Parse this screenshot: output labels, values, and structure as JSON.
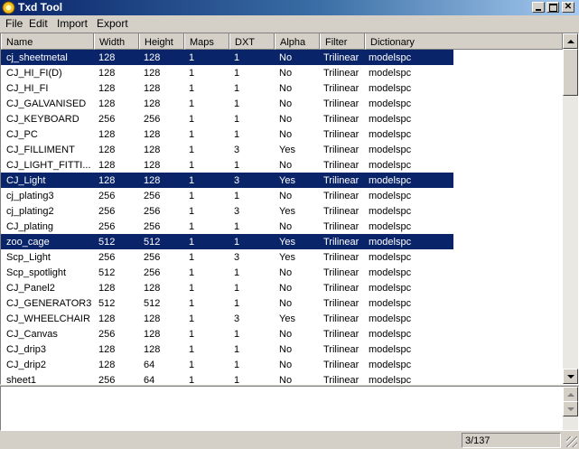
{
  "window": {
    "title": "Txd Tool"
  },
  "menu": [
    "File",
    "Edit",
    "Import",
    "Export"
  ],
  "columns": [
    "Name",
    "Width",
    "Height",
    "Maps",
    "DXT",
    "Alpha",
    "Filter",
    "Dictionary"
  ],
  "rows": [
    {
      "name": "cj_sheetmetal",
      "width": "128",
      "height": "128",
      "maps": "1",
      "dxt": "1",
      "alpha": "No",
      "filter": "Trilinear",
      "dict": "modelspc",
      "selected": true
    },
    {
      "name": "CJ_HI_FI(D)",
      "width": "128",
      "height": "128",
      "maps": "1",
      "dxt": "1",
      "alpha": "No",
      "filter": "Trilinear",
      "dict": "modelspc",
      "selected": false
    },
    {
      "name": "CJ_HI_FI",
      "width": "128",
      "height": "128",
      "maps": "1",
      "dxt": "1",
      "alpha": "No",
      "filter": "Trilinear",
      "dict": "modelspc",
      "selected": false
    },
    {
      "name": "CJ_GALVANISED",
      "width": "128",
      "height": "128",
      "maps": "1",
      "dxt": "1",
      "alpha": "No",
      "filter": "Trilinear",
      "dict": "modelspc",
      "selected": false
    },
    {
      "name": "CJ_KEYBOARD",
      "width": "256",
      "height": "256",
      "maps": "1",
      "dxt": "1",
      "alpha": "No",
      "filter": "Trilinear",
      "dict": "modelspc",
      "selected": false
    },
    {
      "name": "CJ_PC",
      "width": "128",
      "height": "128",
      "maps": "1",
      "dxt": "1",
      "alpha": "No",
      "filter": "Trilinear",
      "dict": "modelspc",
      "selected": false
    },
    {
      "name": "CJ_FILLIMENT",
      "width": "128",
      "height": "128",
      "maps": "1",
      "dxt": "3",
      "alpha": "Yes",
      "filter": "Trilinear",
      "dict": "modelspc",
      "selected": false
    },
    {
      "name": "CJ_LIGHT_FITTI...",
      "width": "128",
      "height": "128",
      "maps": "1",
      "dxt": "1",
      "alpha": "No",
      "filter": "Trilinear",
      "dict": "modelspc",
      "selected": false
    },
    {
      "name": "CJ_Light",
      "width": "128",
      "height": "128",
      "maps": "1",
      "dxt": "3",
      "alpha": "Yes",
      "filter": "Trilinear",
      "dict": "modelspc",
      "selected": true
    },
    {
      "name": "cj_plating3",
      "width": "256",
      "height": "256",
      "maps": "1",
      "dxt": "1",
      "alpha": "No",
      "filter": "Trilinear",
      "dict": "modelspc",
      "selected": false
    },
    {
      "name": "cj_plating2",
      "width": "256",
      "height": "256",
      "maps": "1",
      "dxt": "3",
      "alpha": "Yes",
      "filter": "Trilinear",
      "dict": "modelspc",
      "selected": false
    },
    {
      "name": "CJ_plating",
      "width": "256",
      "height": "256",
      "maps": "1",
      "dxt": "1",
      "alpha": "No",
      "filter": "Trilinear",
      "dict": "modelspc",
      "selected": false
    },
    {
      "name": "zoo_cage",
      "width": "512",
      "height": "512",
      "maps": "1",
      "dxt": "1",
      "alpha": "Yes",
      "filter": "Trilinear",
      "dict": "modelspc",
      "selected": true
    },
    {
      "name": "Scp_Light",
      "width": "256",
      "height": "256",
      "maps": "1",
      "dxt": "3",
      "alpha": "Yes",
      "filter": "Trilinear",
      "dict": "modelspc",
      "selected": false
    },
    {
      "name": "Scp_spotlight",
      "width": "512",
      "height": "256",
      "maps": "1",
      "dxt": "1",
      "alpha": "No",
      "filter": "Trilinear",
      "dict": "modelspc",
      "selected": false
    },
    {
      "name": "CJ_Panel2",
      "width": "128",
      "height": "128",
      "maps": "1",
      "dxt": "1",
      "alpha": "No",
      "filter": "Trilinear",
      "dict": "modelspc",
      "selected": false
    },
    {
      "name": "CJ_GENERATOR3",
      "width": "512",
      "height": "512",
      "maps": "1",
      "dxt": "1",
      "alpha": "No",
      "filter": "Trilinear",
      "dict": "modelspc",
      "selected": false
    },
    {
      "name": "CJ_WHEELCHAIR",
      "width": "128",
      "height": "128",
      "maps": "1",
      "dxt": "3",
      "alpha": "Yes",
      "filter": "Trilinear",
      "dict": "modelspc",
      "selected": false
    },
    {
      "name": "CJ_Canvas",
      "width": "256",
      "height": "128",
      "maps": "1",
      "dxt": "1",
      "alpha": "No",
      "filter": "Trilinear",
      "dict": "modelspc",
      "selected": false
    },
    {
      "name": "CJ_drip3",
      "width": "128",
      "height": "128",
      "maps": "1",
      "dxt": "1",
      "alpha": "No",
      "filter": "Trilinear",
      "dict": "modelspc",
      "selected": false
    },
    {
      "name": "CJ_drip2",
      "width": "128",
      "height": "64",
      "maps": "1",
      "dxt": "1",
      "alpha": "No",
      "filter": "Trilinear",
      "dict": "modelspc",
      "selected": false
    },
    {
      "name": "sheet1",
      "width": "256",
      "height": "64",
      "maps": "1",
      "dxt": "1",
      "alpha": "No",
      "filter": "Trilinear",
      "dict": "modelspc",
      "selected": false
    }
  ],
  "status": {
    "count": "3/137"
  },
  "colors": {
    "selection": "#0a246a",
    "face": "#d4d0c8"
  }
}
